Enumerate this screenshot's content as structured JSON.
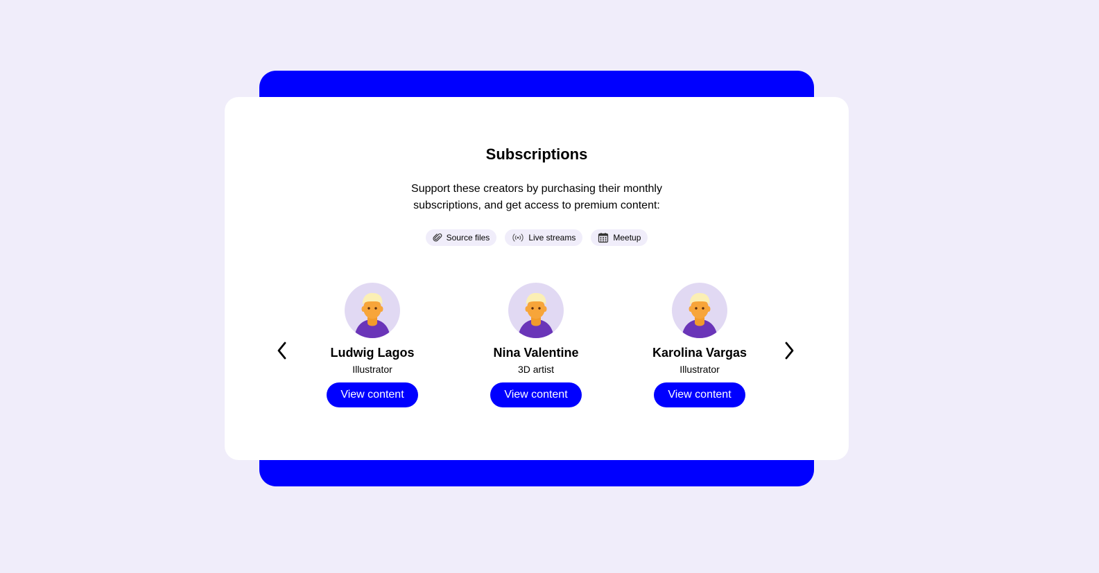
{
  "section": {
    "title": "Subscriptions",
    "description_lines": [
      "Support these creators by purchasing their monthly",
      "subscriptions, and get access to premium content:"
    ]
  },
  "tags": [
    {
      "label": "Source files",
      "icon": "paperclip-icon"
    },
    {
      "label": "Live streams",
      "icon": "broadcast-icon"
    },
    {
      "label": "Meetup",
      "icon": "calendar-icon"
    }
  ],
  "creators": [
    {
      "name": "Ludwig Lagos",
      "role": "Illustrator",
      "button_label": "View content"
    },
    {
      "name": "Nina Valentine",
      "role": "3D artist",
      "button_label": "View content"
    },
    {
      "name": "Karolina Vargas",
      "role": "Illustrator",
      "button_label": "View content"
    }
  ],
  "carousel": {
    "prev_icon": "chevron-left-icon",
    "next_icon": "chevron-right-icon"
  },
  "colors": {
    "page_background": "#f0edfa",
    "accent": "#0000ff",
    "card": "#ffffff",
    "tag_background": "#f0edfa",
    "avatar_background": "#e1d9f3"
  }
}
